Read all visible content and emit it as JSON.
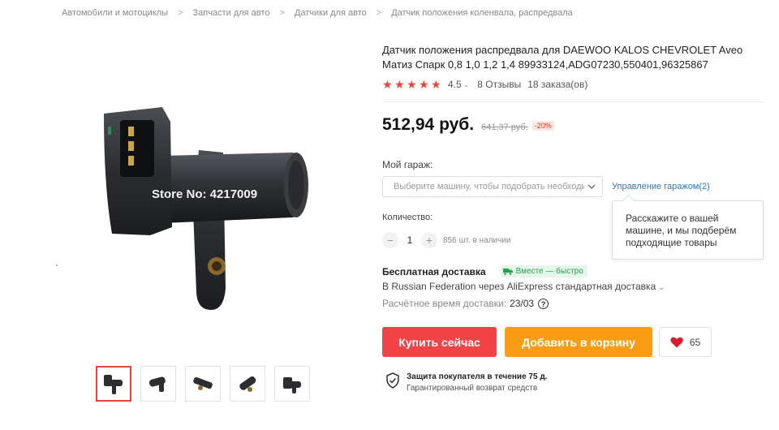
{
  "breadcrumb": {
    "items": [
      "Автомобили и мотоциклы",
      "Запчасти для авто",
      "Датчики для авто",
      "Датчик положения коленвала, распредвала"
    ],
    "separator": ">"
  },
  "gallery": {
    "watermark": "Store No: 4217009",
    "thumbnail_count": 5,
    "active_thumbnail": 1
  },
  "product": {
    "title": "Датчик положения распредвала для DAEWOO KALOS CHEVROLET Aveo Матиз Спарк 0,8 1,0 1,2 1,4 89933124,ADG07230,550401,96325867",
    "rating_value": "4.5",
    "rating_stars": 5,
    "reviews": "8 Отзывы",
    "orders": "18 заказа(ов)",
    "price": "512,94 руб.",
    "old_price": "641,37 руб.",
    "discount": "-20%"
  },
  "garage": {
    "label": "Мой гараж:",
    "placeholder": "Выберите машину, чтобы подобрать необходимое",
    "manage_link": "Управление гаражом(2)",
    "tooltip": "Расскажите о вашей машине, и мы подберём подходящие товары"
  },
  "quantity": {
    "label": "Количество:",
    "value": "1",
    "decrement": "−",
    "increment": "+",
    "stock": "856 шт. в наличии"
  },
  "shipping": {
    "title": "Бесплатная доставка",
    "badge": "Вместе — быстро",
    "detail": "В Russian Federation через AliExpress стандартная доставка",
    "time_label": "Расчётное время доставки:",
    "time_value": "23/03",
    "help": "?"
  },
  "actions": {
    "buy_now": "Купить сейчас",
    "add_to_cart": "Добавить в корзину",
    "wishlist_count": "65"
  },
  "protection": {
    "title": "Защита покупателя в течение 75 д.",
    "subtitle": "Гарантированный возврат средств"
  },
  "colors": {
    "accent_red": "#f44346",
    "accent_orange": "#fb9c13",
    "star": "#f44336",
    "link": "#2a7ab8",
    "badge_green": "#22a34a"
  },
  "icons": [
    "chevron-down-icon",
    "star-icon",
    "truck-icon",
    "question-icon",
    "heart-icon",
    "shield-check-icon"
  ]
}
